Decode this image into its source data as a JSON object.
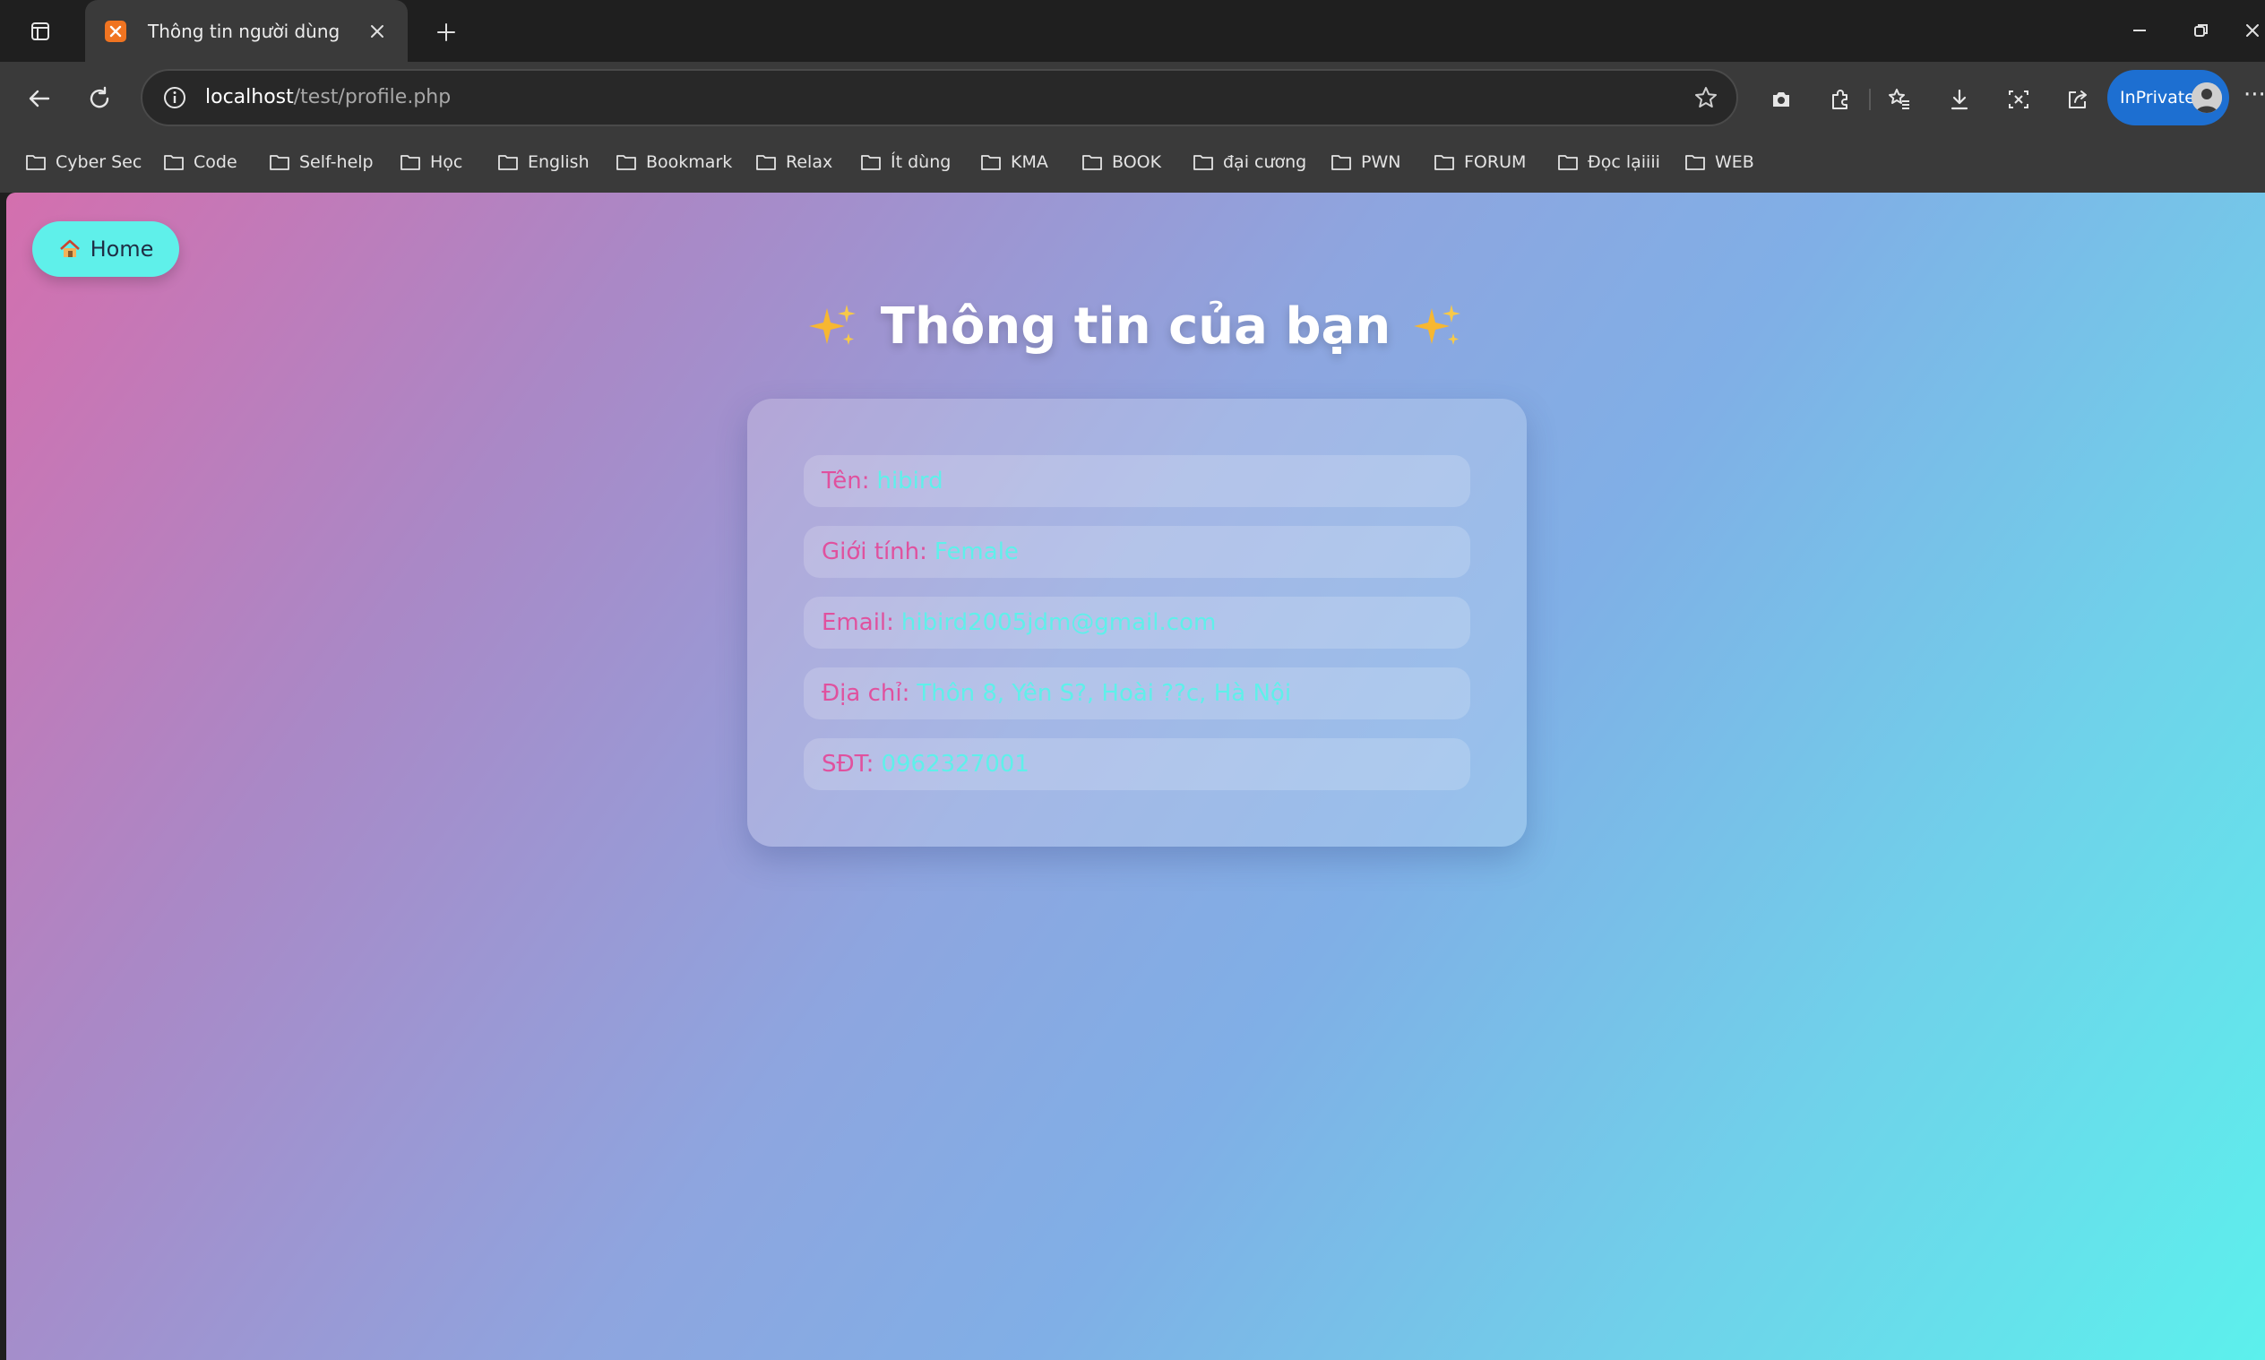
{
  "browser": {
    "tab": {
      "title": "Thông tin người dùng"
    },
    "url": {
      "host": "localhost",
      "path": "/test/profile.php"
    },
    "profile_label": "InPrivate",
    "more_label": "···"
  },
  "bookmarks": [
    {
      "label": "Cyber Sec"
    },
    {
      "label": "Code"
    },
    {
      "label": "Self-help"
    },
    {
      "label": "Học"
    },
    {
      "label": "English"
    },
    {
      "label": "Bookmark"
    },
    {
      "label": "Relax"
    },
    {
      "label": "Ít dùng"
    },
    {
      "label": "KMA"
    },
    {
      "label": "BOOK"
    },
    {
      "label": "đại cương"
    },
    {
      "label": "PWN"
    },
    {
      "label": "FORUM"
    },
    {
      "label": "Đọc lạiiii"
    },
    {
      "label": "WEB"
    }
  ],
  "page": {
    "home_label": "Home",
    "title": "Thông tin của bạn",
    "fields": [
      {
        "label": "Tên:",
        "value": "hibird"
      },
      {
        "label": "Giới tính:",
        "value": "Female"
      },
      {
        "label": "Email:",
        "value": "hibird2005jdm@gmail.com"
      },
      {
        "label": "Địa chỉ:",
        "value": "Thôn 8, Yên S?, Hoài ??c, Hà Nội"
      },
      {
        "label": "SĐT:",
        "value": "0962327001"
      }
    ]
  },
  "colors": {
    "label": "#e0519e",
    "value": "#5ff0ea",
    "home_button": "#5ff0ea",
    "inprivate": "#1d6fd1"
  }
}
